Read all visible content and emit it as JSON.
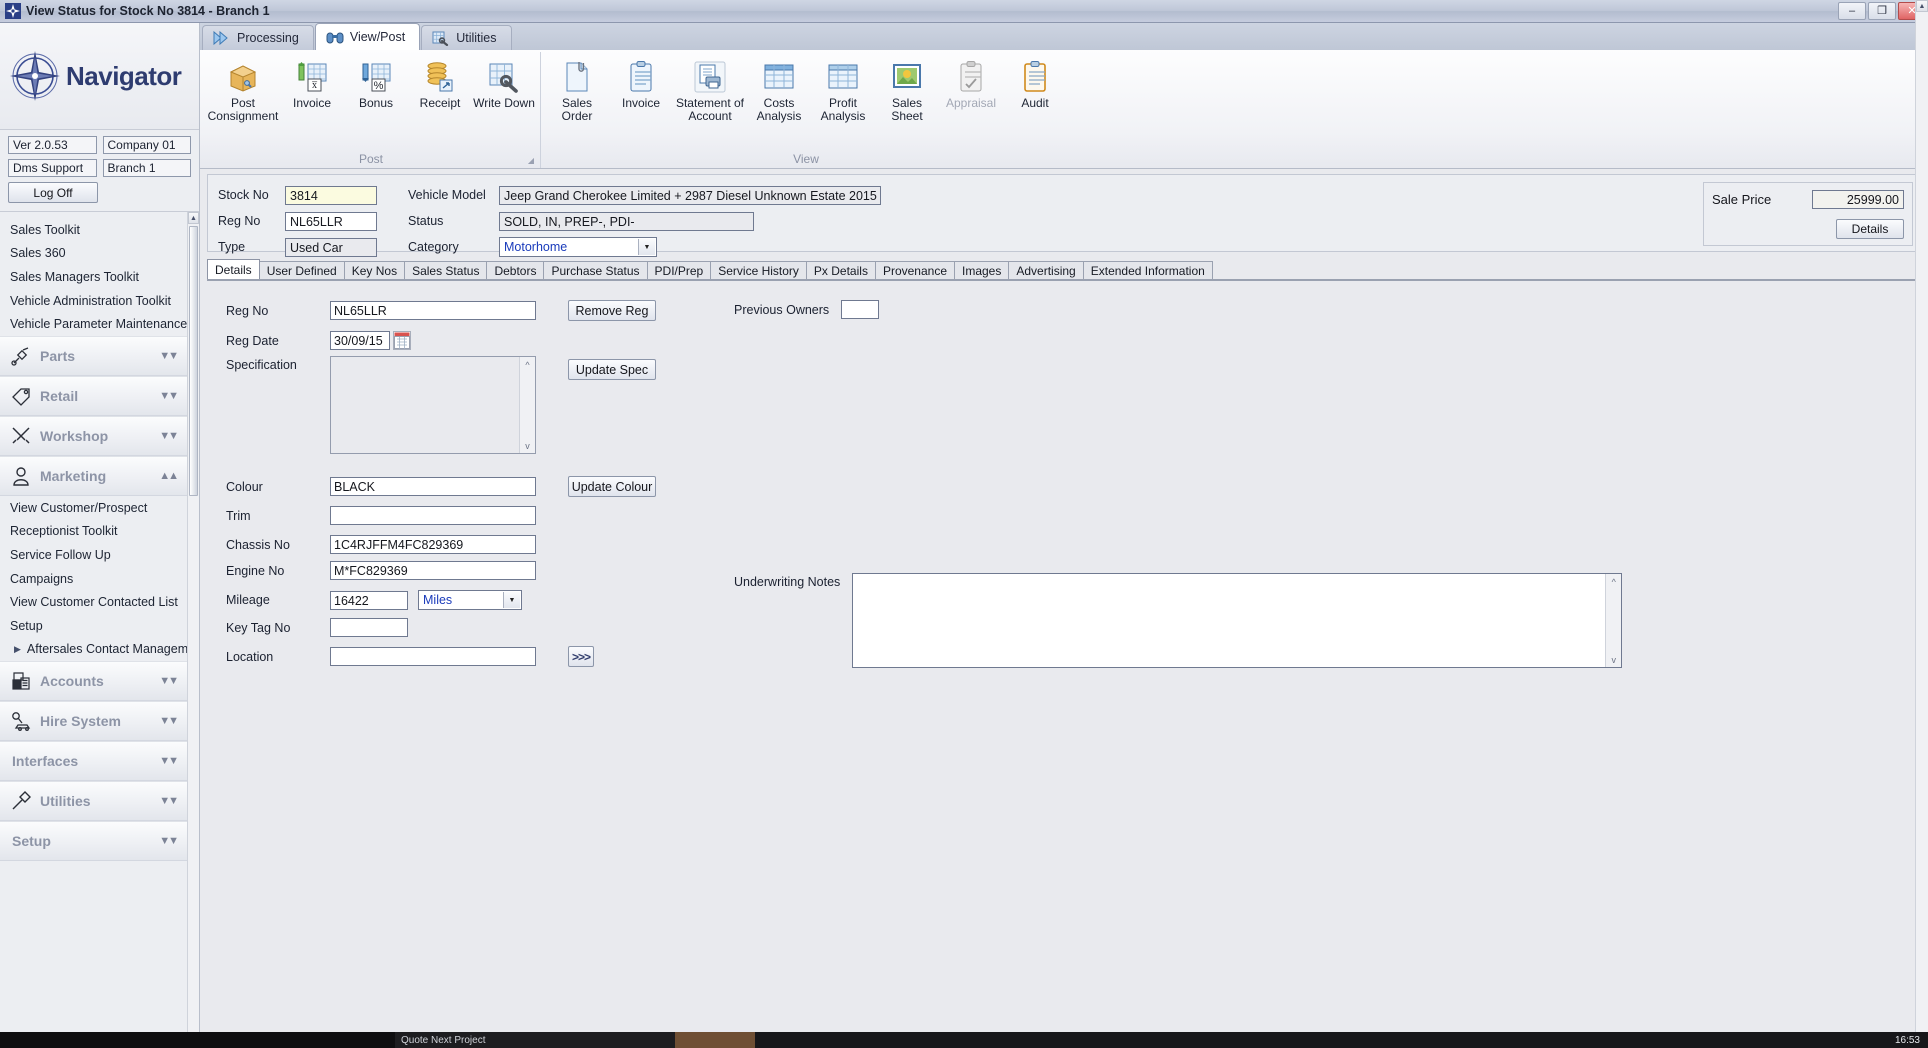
{
  "window": {
    "title": "View Status for Stock No 3814 - Branch 1",
    "icon": "compass-icon",
    "buttons": {
      "minimize": "–",
      "maximize": "❐",
      "close": "✕"
    }
  },
  "sidebar": {
    "brand": "Navigator",
    "version": "Ver 2.0.53",
    "company": "Company 01",
    "user": "Dms Support",
    "branch": "Branch 1",
    "logoff_label": "Log Off",
    "links": [
      "Sales Toolkit",
      "Sales 360",
      "Sales Managers Toolkit",
      "Vehicle Administration Toolkit",
      "Vehicle Parameter Maintenance"
    ],
    "groups": [
      {
        "label": "Parts",
        "icon": "spark-plug-icon",
        "expanded": false
      },
      {
        "label": "Retail",
        "icon": "price-tag-icon",
        "expanded": false
      },
      {
        "label": "Workshop",
        "icon": "tools-icon",
        "expanded": false
      },
      {
        "label": "Marketing",
        "icon": "person-icon",
        "expanded": true
      }
    ],
    "marketing_links": [
      "View Customer/Prospect",
      "Receptionist Toolkit",
      "Service Follow Up",
      "Campaigns",
      "View Customer Contacted List",
      "Setup"
    ],
    "marketing_subitem": "Aftersales Contact Management",
    "lower_groups": [
      {
        "label": "Accounts",
        "icon": "ledger-icon"
      },
      {
        "label": "Hire System",
        "icon": "key-car-icon"
      },
      {
        "label": "Interfaces",
        "icon": "none"
      },
      {
        "label": "Utilities",
        "icon": "hammer-icon"
      },
      {
        "label": "Setup",
        "icon": "none"
      }
    ]
  },
  "ribbon": {
    "tabs": [
      {
        "label": "Processing",
        "icon": "fast-forward-icon",
        "active": false
      },
      {
        "label": "View/Post",
        "icon": "binoculars-icon",
        "active": true
      },
      {
        "label": "Utilities",
        "icon": "table-wrench-icon",
        "active": false
      }
    ],
    "groups": [
      {
        "title": "Post",
        "buttons": [
          {
            "label": "Post Consignment",
            "icon": "box-tag-icon",
            "disabled": false
          },
          {
            "label": "Invoice",
            "icon": "invoice-up-icon",
            "disabled": false
          },
          {
            "label": "Bonus",
            "icon": "percent-table-icon",
            "disabled": false
          },
          {
            "label": "Receipt",
            "icon": "coins-icon",
            "disabled": false
          },
          {
            "label": "Write Down",
            "icon": "table-wrench-icon",
            "disabled": false
          }
        ]
      },
      {
        "title": "View",
        "buttons": [
          {
            "label": "Sales Order",
            "icon": "document-clip-icon",
            "disabled": false
          },
          {
            "label": "Invoice",
            "icon": "clipboard-icon",
            "disabled": false
          },
          {
            "label": "Statement of Account",
            "icon": "print-document-icon",
            "disabled": false
          },
          {
            "label": "Costs Analysis",
            "icon": "grid-table-icon",
            "disabled": false
          },
          {
            "label": "Profit Analysis",
            "icon": "grid-table-icon",
            "disabled": false
          },
          {
            "label": "Sales Sheet",
            "icon": "picture-icon",
            "disabled": false
          },
          {
            "label": "Appraisal",
            "icon": "clipboard-check-icon",
            "disabled": true
          },
          {
            "label": "Audit",
            "icon": "clipboard-orange-icon",
            "disabled": false
          }
        ]
      }
    ]
  },
  "header": {
    "fields": [
      {
        "label": "Stock No",
        "value": "3814",
        "style": "highlight"
      },
      {
        "label": "Reg No",
        "value": "NL65LLR",
        "style": "normal"
      },
      {
        "label": "Type",
        "value": "Used Car",
        "style": "readonly"
      }
    ],
    "fields2": [
      {
        "label": "Vehicle Model",
        "value": "Jeep Grand Cherokee Limited + 2987 Diesel Unknown Estate 2015",
        "style": "readonly"
      },
      {
        "label": "Status",
        "value": "SOLD, IN, PREP-, PDI-",
        "style": "readonly"
      }
    ],
    "category": {
      "label": "Category",
      "value": "Motorhome"
    },
    "sale_price": {
      "label": "Sale Price",
      "value": "25999.00",
      "details_label": "Details"
    }
  },
  "tabs": [
    {
      "label": "Details",
      "active": true
    },
    {
      "label": "User Defined",
      "active": false
    },
    {
      "label": "Key Nos",
      "active": false
    },
    {
      "label": "Sales Status",
      "active": false
    },
    {
      "label": "Debtors",
      "active": false
    },
    {
      "label": "Purchase Status",
      "active": false
    },
    {
      "label": "PDI/Prep",
      "active": false
    },
    {
      "label": "Service History",
      "active": false
    },
    {
      "label": "Px Details",
      "active": false
    },
    {
      "label": "Provenance",
      "active": false
    },
    {
      "label": "Images",
      "active": false
    },
    {
      "label": "Advertising",
      "active": false
    },
    {
      "label": "Extended Information",
      "active": false
    }
  ],
  "details": {
    "reg_no": {
      "label": "Reg No",
      "value": "NL65LLR"
    },
    "remove_reg_label": "Remove Reg",
    "reg_date": {
      "label": "Reg Date",
      "value": "30/09/15",
      "icon": "calendar-icon"
    },
    "specification": {
      "label": "Specification",
      "value": ""
    },
    "update_spec_label": "Update Spec",
    "colour": {
      "label": "Colour",
      "value": "BLACK"
    },
    "update_colour_label": "Update Colour",
    "trim": {
      "label": "Trim",
      "value": ""
    },
    "chassis_no": {
      "label": "Chassis No",
      "value": "1C4RJFFM4FC829369"
    },
    "engine_no": {
      "label": "Engine No",
      "value": "M*FC829369"
    },
    "mileage": {
      "label": "Mileage",
      "value": "16422",
      "unit": "Miles"
    },
    "key_tag_no": {
      "label": "Key Tag No",
      "value": ""
    },
    "location": {
      "label": "Location",
      "value": "",
      "expand_label": ">>>"
    },
    "previous_owners": {
      "label": "Previous Owners",
      "value": ""
    },
    "underwriting_notes": {
      "label": "Underwriting Notes",
      "value": ""
    }
  },
  "taskbar": {
    "item_label": "Quote Next Project",
    "clock": "16:53"
  }
}
